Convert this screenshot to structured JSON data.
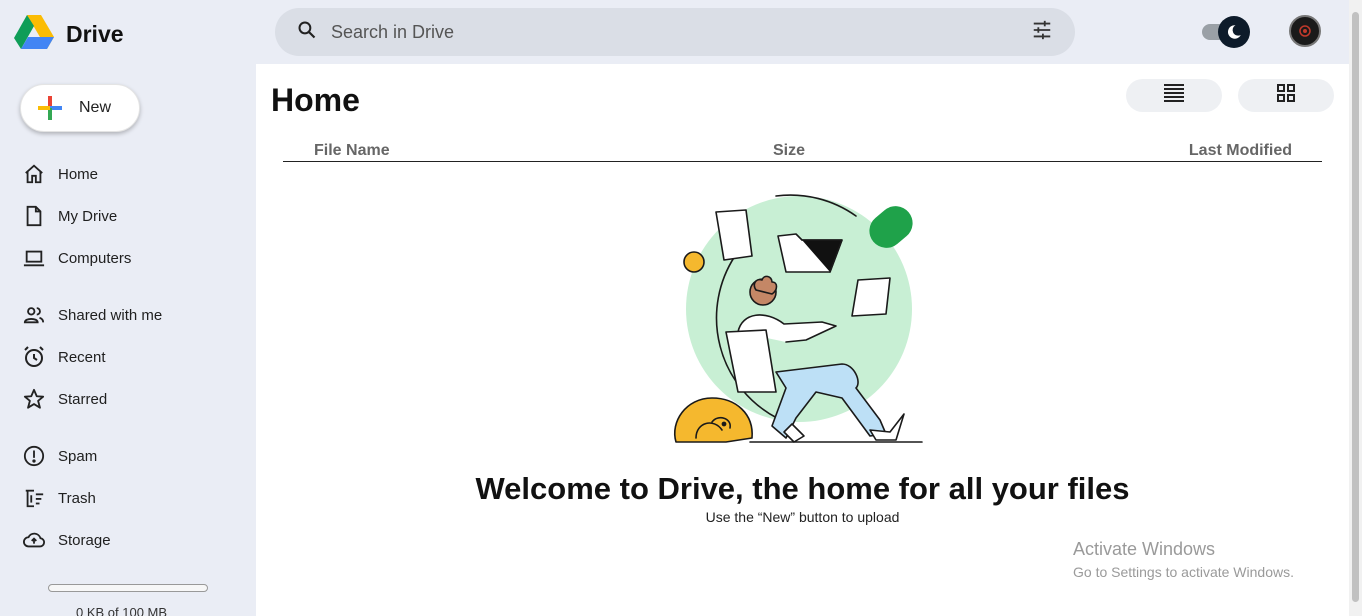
{
  "app": {
    "title": "Drive"
  },
  "search": {
    "placeholder": "Search in Drive"
  },
  "sidebar": {
    "new_label": "New",
    "items": [
      {
        "label": "Home",
        "icon": "home-icon"
      },
      {
        "label": "My Drive",
        "icon": "file-icon"
      },
      {
        "label": "Computers",
        "icon": "laptop-icon"
      },
      {
        "label": "Shared with me",
        "icon": "people-icon"
      },
      {
        "label": "Recent",
        "icon": "clock-icon"
      },
      {
        "label": "Starred",
        "icon": "star-icon"
      },
      {
        "label": "Spam",
        "icon": "spam-icon"
      },
      {
        "label": "Trash",
        "icon": "trash-icon"
      },
      {
        "label": "Storage",
        "icon": "cloud-icon"
      }
    ],
    "storage": {
      "used_fraction": 0,
      "text": "0 KB of 100 MB"
    }
  },
  "main": {
    "title": "Home",
    "columns": {
      "name": "File Name",
      "size": "Size",
      "modified": "Last Modified"
    },
    "empty": {
      "heading": "Welcome to Drive, the home for all your files",
      "subtext": "Use the “New” button to upload"
    }
  },
  "watermark": {
    "line1": "Activate Windows",
    "line2": "Go to Settings to activate Windows."
  },
  "colors": {
    "accent": "#1a73e8",
    "sidebar_bg": "#eaedf5",
    "illustration_green": "#c8efd4",
    "dog_yellow": "#f5b82e"
  }
}
